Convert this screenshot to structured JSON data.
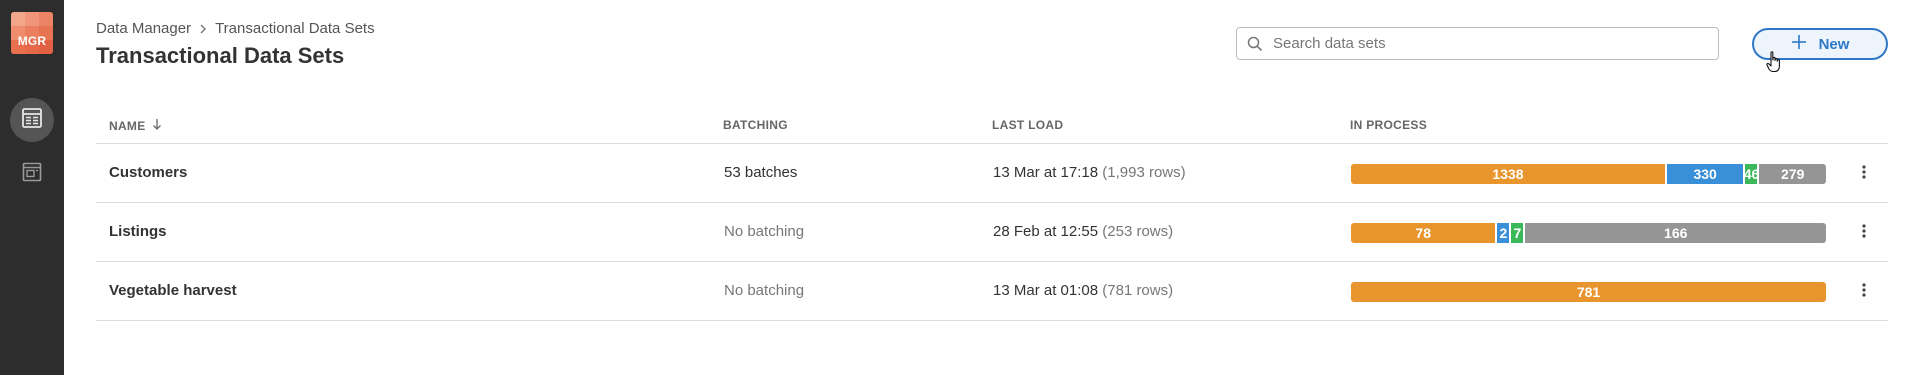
{
  "app": {
    "logo_text": "MGR",
    "logo_color": "#e8704f"
  },
  "sidebar": {
    "items": [
      {
        "icon": "data-table-icon",
        "active": true
      },
      {
        "icon": "document-panel-icon",
        "active": false
      }
    ]
  },
  "header": {
    "breadcrumb": [
      "Data Manager",
      "Transactional Data Sets"
    ],
    "title": "Transactional Data Sets",
    "search": {
      "placeholder": "Search data sets",
      "value": ""
    },
    "new_label": "New"
  },
  "table": {
    "columns": {
      "name": "NAME",
      "batching": "BATCHING",
      "last_load": "LAST LOAD",
      "in_process": "IN PROCESS"
    },
    "sort": {
      "column": "name",
      "direction": "descending-arrow"
    },
    "rows": [
      {
        "name": "Customers",
        "batching": "53 batches",
        "batching_muted": false,
        "last_load": "13 Mar at 17:18",
        "rows": "(1,993 rows)",
        "segments": [
          {
            "value": 1338,
            "label": "1338",
            "color": "#e8952e"
          },
          {
            "value": 330,
            "label": "330",
            "color": "#3a8fd9"
          },
          {
            "value": 46,
            "label": "46",
            "color": "#3bb85a"
          },
          {
            "value": 279,
            "label": "279",
            "color": "#959595"
          }
        ]
      },
      {
        "name": "Listings",
        "batching": "No batching",
        "batching_muted": true,
        "last_load": "28 Feb at 12:55",
        "rows": "(253 rows)",
        "segments": [
          {
            "value": 78,
            "label": "78",
            "color": "#e8952e"
          },
          {
            "value": 2,
            "label": "2",
            "color": "#3a8fd9"
          },
          {
            "value": 7,
            "label": "7",
            "color": "#3bb85a"
          },
          {
            "value": 166,
            "label": "166",
            "color": "#959595"
          }
        ]
      },
      {
        "name": "Vegetable harvest",
        "batching": "No batching",
        "batching_muted": true,
        "last_load": "13 Mar at 01:08",
        "rows": "(781 rows)",
        "segments": [
          {
            "value": 781,
            "label": "781",
            "color": "#e8952e"
          }
        ]
      }
    ]
  }
}
